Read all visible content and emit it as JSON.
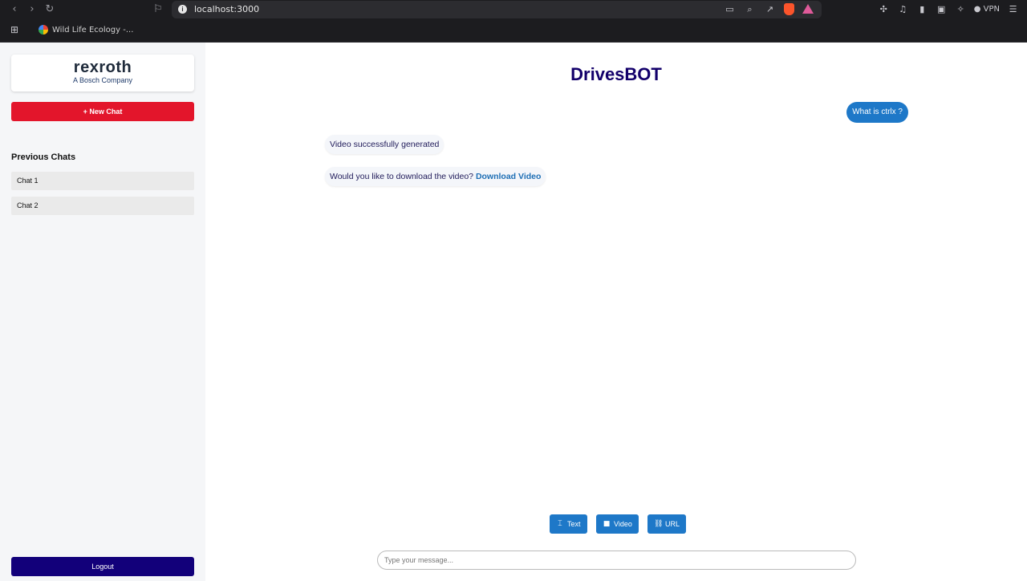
{
  "browser": {
    "url": "localhost:3000",
    "bookmark": "Wild Life Ecology -...",
    "vpn_label": "VPN"
  },
  "sidebar": {
    "logo_main": "rexroth",
    "logo_sub": "A Bosch Company",
    "new_chat": "+ New Chat",
    "previous_title": "Previous Chats",
    "chats": [
      "Chat 1",
      "Chat 2"
    ],
    "logout": "Logout"
  },
  "main": {
    "title": "DrivesBOT",
    "user_message": "What is ctrlx ?",
    "bot_message_1": "Video successfully generated",
    "bot_message_2": "Would you like to download the video?",
    "download_link": "Download Video",
    "modes": [
      "Text",
      "Video",
      "URL"
    ],
    "input_placeholder": "Type your message..."
  },
  "colors": {
    "accent_red": "#e3152b",
    "accent_navy": "#12007a",
    "accent_blue": "#1e78c8",
    "title": "#13006b"
  },
  "icons": {
    "text": "text-icon",
    "video": "video-camera-icon",
    "url": "link-icon"
  }
}
